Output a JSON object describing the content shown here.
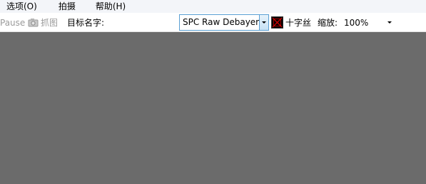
{
  "menu": {
    "items": [
      {
        "label": "选项(O)"
      },
      {
        "label": "拍摄"
      },
      {
        "label": "帮助(H)"
      }
    ]
  },
  "toolbar": {
    "pause_label": "Pause",
    "capture_label": "抓图",
    "target_label": "目标名字:",
    "target_value": "",
    "source_combo_value": "SPC Raw Debayer",
    "crosshair_label": "十字丝",
    "zoom_label": "缩放:",
    "zoom_value": "100%"
  },
  "icons": {
    "capture": "camera-icon",
    "crosshair": "crosshair-icon",
    "dropdown": "chevron-down-icon"
  },
  "colors": {
    "viewer_background": "#6b6b6b",
    "combo_border": "#5a9fd4",
    "crosshair_red": "#cc0000",
    "disabled_text": "#9a9a9a"
  }
}
